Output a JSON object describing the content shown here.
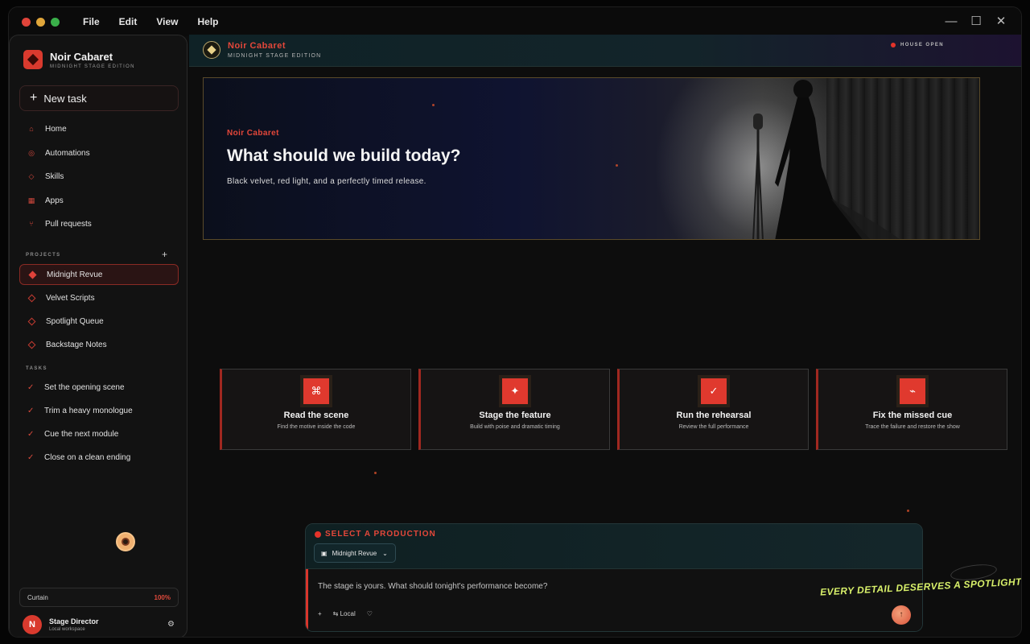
{
  "window": {
    "menu": [
      "File",
      "Edit",
      "View",
      "Help"
    ],
    "controls": {
      "minimize": "—",
      "maximize": "☐",
      "close": "✕"
    }
  },
  "sidebar": {
    "brand_name": "Noir Cabaret",
    "brand_sub": "MIDNIGHT STAGE EDITION",
    "new_task_label": "New task",
    "nav": [
      {
        "label": "Home",
        "icon": "home-icon"
      },
      {
        "label": "Automations",
        "icon": "automation-icon"
      },
      {
        "label": "Skills",
        "icon": "skills-icon"
      },
      {
        "label": "Apps",
        "icon": "apps-icon"
      },
      {
        "label": "Pull requests",
        "icon": "pull-request-icon"
      }
    ],
    "projects_label": "PROJECTS",
    "projects_add": "+",
    "projects": [
      {
        "label": "Midnight Revue",
        "active": true
      },
      {
        "label": "Velvet Scripts",
        "active": false
      },
      {
        "label": "Spotlight Queue",
        "active": false
      },
      {
        "label": "Backstage Notes",
        "active": false
      }
    ],
    "tasks_label": "TASKS",
    "tasks": [
      {
        "label": "Set the opening scene"
      },
      {
        "label": "Trim a heavy monologue"
      },
      {
        "label": "Cue the next module"
      },
      {
        "label": "Close on a clean ending"
      }
    ],
    "curtain_label": "Curtain",
    "curtain_value": "100%",
    "user_initial": "N",
    "user_name": "Stage Director",
    "user_sub": "Local workspace"
  },
  "header": {
    "title": "Noir Cabaret",
    "subtitle": "MIDNIGHT STAGE EDITION",
    "status": "HOUSE OPEN"
  },
  "hero": {
    "kicker": "Noir Cabaret",
    "title": "What should we build today?",
    "subtitle": "Black velvet, red light, and a perfectly timed release."
  },
  "cards": [
    {
      "icon": "⌘",
      "title": "Read the scene",
      "sub": "Find the motive inside the code"
    },
    {
      "icon": "✦",
      "title": "Stage the feature",
      "sub": "Build with poise and dramatic timing"
    },
    {
      "icon": "✓",
      "title": "Run the rehearsal",
      "sub": "Review the full performance"
    },
    {
      "icon": "⌁",
      "title": "Fix the missed cue",
      "sub": "Trace the failure and restore the show"
    }
  ],
  "composer": {
    "select_label": "SELECT A PRODUCTION",
    "selected_production": "Midnight Revue",
    "placeholder": "The stage is yours. What should tonight's performance become?",
    "tool_add": "+",
    "tool_local": "⇆ Local",
    "tool_shield": "♡",
    "send": "↑"
  },
  "tagline": "EVERY DETAIL DESERVES A SPOTLIGHT.",
  "colors": {
    "accent": "#e0392e",
    "tagline": "#d8f06a",
    "background": "#0d0d0d"
  }
}
